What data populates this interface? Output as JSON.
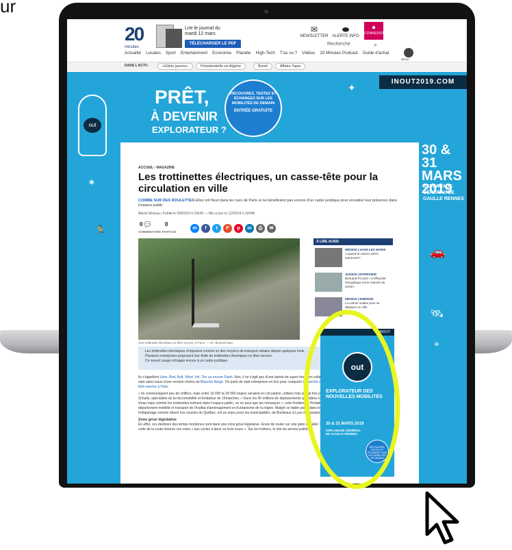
{
  "corner_text": "ur",
  "header": {
    "logo": "20",
    "logo_sub": "minutes",
    "journal_line1": "Lire le journal du",
    "journal_line2": "mardi 12 mars",
    "download_button": "TÉLÉCHARGER LE PDF",
    "newsletter": "NEWSLETTER",
    "alerts": "ALERTE INFO",
    "connexion": "CONNEXION",
    "search_placeholder": "Recherche",
    "nav": [
      "Actualité",
      "Locales",
      "Sport",
      "Entertainment",
      "Economie",
      "Planète",
      "High-Tech",
      "T'as vu ?",
      "Vidéos",
      "20 Minutes Podcast",
      "Guide d'achat"
    ],
    "menu_label": "MENU"
  },
  "tagsbar": {
    "label": "DANS L'ACTU",
    "tags": [
      "«Gilets jaunes»",
      "Présidentielle en Algérie",
      "Brexit",
      "Affaire Tapie"
    ]
  },
  "ad": {
    "domain": "INOUT2019.COM",
    "headline1": "PRÊT,",
    "headline2": "À DEVENIR",
    "headline3": "EXPLORATEUR ?",
    "badge_text": "DÉCOUVREZ, TESTEZ ET ÉCHANGEZ SUR LES MOBILITÉS DE DEMAIN",
    "badge_strong": "ENTRÉE GRATUITE",
    "dates_line1": "30 & 31",
    "dates_line2": "MARS",
    "dates_line3": "2019",
    "place": "ESPLANADE GÉNÉRAL DE GAULLE RENNES",
    "logo": "out"
  },
  "article": {
    "breadcrumb": "ACCUEIL › MAGAZINE",
    "title": "Les trottinettes électriques, un casse-tête pour la circulation en ville",
    "lead_strong": "COMME SUR DES ROULETTES",
    "lead_rest": " Elles ont fleuri dans les rues de Paris et ne bénéficient pas encore d'un cadre juridique pour encadrer leur présence dans l'espace public",
    "author": "Alexis Moreau  |  Publié le 09/03/19 à 15h00 — Mis à jour le 11/03/19 à 10h48",
    "comments_count": "0",
    "comments_label": "COMMENTAIRE",
    "shares_count": "0",
    "shares_label": "PARTAGE",
    "caption": "Une trottinette électrique en libre service, à Paris.  — M. Alloume/Sipa",
    "bullets": [
      "Les trottinettes électriques s'imposent comme un des moyens de transport urbains depuis quelques mois.",
      "Plusieurs entreprises proposent leur flotte de trottinettes électriques en libre-service.",
      "Ce nouvel usage échappe encore à un cadre juridique."
    ],
    "para1_a": "Ils s'appellent ",
    "para1_link": "Lime, Bird, Bolt, Wind, Voi, Tier ou encore Flash",
    "para1_b": ". Non, il ne s'agit pas d'une bande de super-héros en collants venus sauver le monde, ni de sept nains issus d'une version chelou de ",
    "para1_link2": "Blanche-Neige",
    "para1_c": ". On parle de sept entreprises en lice pour conquérir le ",
    "para1_link3": "marché des trottinettes électriques en libre-service à Paris",
    "para2": "« Ils communiquent peu de chiffres, mais entre 10 000 et 20 000 engins seraient en circulation, utilisés trois à sept fois par jour », explique Stéphane Schultz, spécialiste de la micromobilité et fondateur de 15marches. « Dans les 40 millions de déplacements quotidiens en Ile-de-France, c'est une goutte d'eau mais comme les trottinettes traînent dans l'espace public, on ne peut que les remarquer », note Frédérique Prédali, chargée d'étude au département mobilité et transport de l'Institut d'aménagement et d'urbanisme de la région. Malgré ce faible poids dans les migrations quotidiennes, le trottipartage comme disent nos cousins du Québec, est un enjeu pour les municipalités, de Bordeaux à Lyon en passant par Nantes.",
    "subhead": "Zone grise législative",
    "para3": "En effet, ces destriers des temps modernes sont dans une zone grise législative. Envie de rouler sur une piste cyclable ? Impossible. L'article R110-2 du code de la route réserve ces voies « aux cycles à deux ou trois roues ». Sur les trottoirs, le site du service public"
  },
  "sidebar": {
    "heading": "À LIRE AUSSI",
    "items": [
      {
        "tag": "08/03/19 | SANS LES MAINS",
        "text": "A quand la voiture 100% autonome?"
      },
      {
        "tag": "11/03/19 | INTERVIEW",
        "text": "Bertrand Piccard: «L'efficacité énergétique est le marché du siècle»"
      },
      {
        "tag": "08/03/19 | ENERGIE",
        "text": "La voiture solaire pour se déplacer en ville"
      }
    ]
  },
  "promo": {
    "bar": "INOUT",
    "logo": "out",
    "headline": "EXPLORATEUR DES NOUVELLES MOBILITÉS",
    "date": "30 & 31 MARS 2019",
    "place": "ESPLANADE GÉNÉRAL DE GAULLE RENNES",
    "badge": "DÉCOUVREZ, TESTEZ ET ÉCHANGEZ SUR LES MOBILITÉS DE DEMAIN"
  },
  "colors": {
    "ad_blue": "#23a5d9",
    "brand_navy": "#1c3f73",
    "highlight_yellow": "#e8f521",
    "connexion_pink": "#d1005a"
  }
}
